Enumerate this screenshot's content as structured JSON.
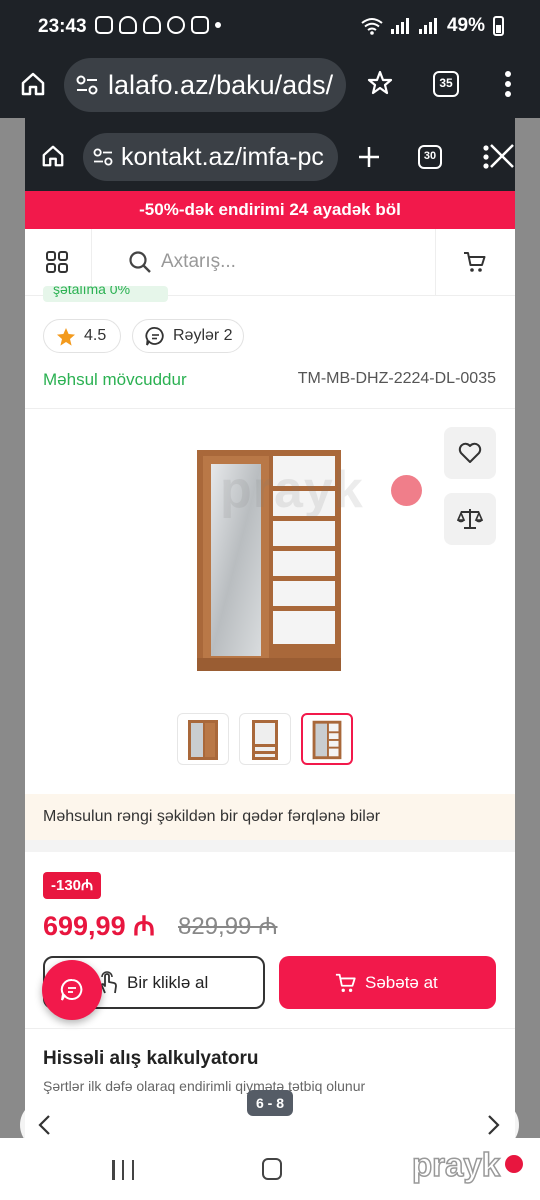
{
  "status_bar": {
    "time": "23:43",
    "battery": "49%"
  },
  "outer_browser": {
    "url": "lalafo.az/baku/ads/",
    "tab_count": "35"
  },
  "inner_browser": {
    "url": "kontakt.az/imfa-pc",
    "tab_count": "30"
  },
  "promo_banner": "-50%-dək endirimi  24 ayadək böl",
  "search": {
    "placeholder": "Axtarış..."
  },
  "product": {
    "partial_label": "şətalıma 0%",
    "rating": "4.5",
    "reviews_label": "Rəylər 2",
    "stock_status": "Məhsul mövcuddur",
    "sku": "TM-MB-DHZ-2224-DL-0035",
    "watermark": "prayk",
    "color_notice": "Məhsulun rəngi şəkildən bir qədər fərqlənə bilər",
    "discount_badge": "-130₼",
    "price": "699,99 ₼",
    "old_price": "829,99 ₼",
    "thumbnails_count": 3,
    "active_thumbnail": 3
  },
  "actions": {
    "one_click": "Bir kliklə al",
    "add_to_cart": "Səbətə at"
  },
  "installment": {
    "title": "Hissəli alış kalkulyatoru",
    "subtitle": "Şərtlər ilk dəfə olaraq endirimli qiymətə tətbiq olunur"
  },
  "gallery_pager": "6 - 8",
  "brand_watermark": "prayk",
  "colors": {
    "accent": "#f2194b",
    "success": "#2bb152",
    "chrome": "#1e2227"
  }
}
